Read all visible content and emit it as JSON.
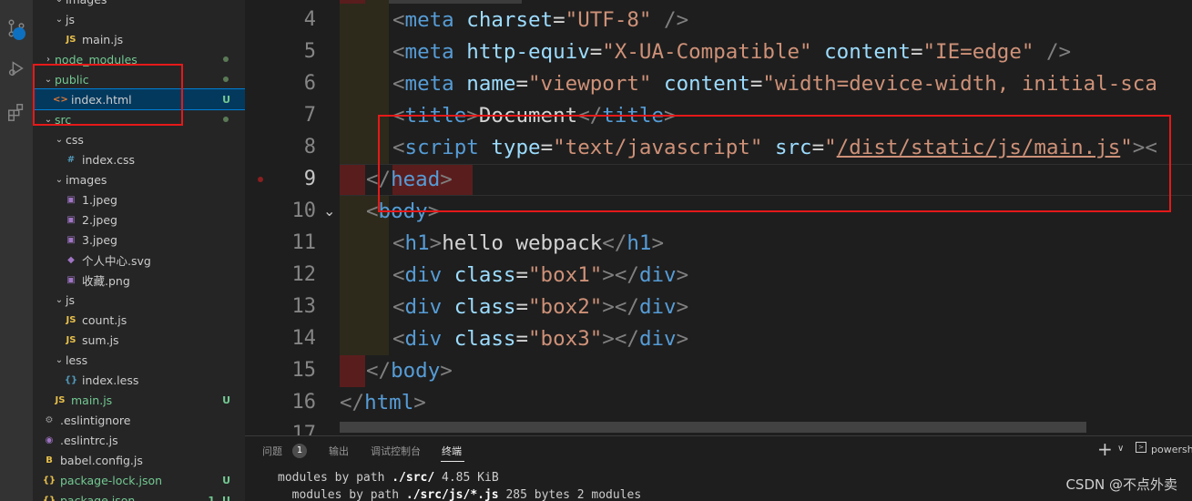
{
  "sidebar": {
    "rows": [
      {
        "label": "images",
        "kind": "folder",
        "depth": 1,
        "color": "",
        "deco": ""
      },
      {
        "label": "js",
        "kind": "folder",
        "depth": 1,
        "color": "",
        "deco": ""
      },
      {
        "label": "main.js",
        "kind": "js",
        "depth": 2,
        "color": "",
        "deco": ""
      },
      {
        "label": "node_modules",
        "kind": "folder-closed",
        "depth": 0,
        "color": "green",
        "deco": "dot"
      },
      {
        "label": "public",
        "kind": "folder",
        "depth": 0,
        "color": "green",
        "deco": "dot"
      },
      {
        "label": "index.html",
        "kind": "html",
        "depth": 1,
        "color": "",
        "deco": "U"
      },
      {
        "label": "src",
        "kind": "folder",
        "depth": 0,
        "color": "green",
        "deco": "dot"
      },
      {
        "label": "css",
        "kind": "folder",
        "depth": 1,
        "color": "",
        "deco": ""
      },
      {
        "label": "index.css",
        "kind": "css",
        "depth": 2,
        "color": "",
        "deco": ""
      },
      {
        "label": "images",
        "kind": "folder",
        "depth": 1,
        "color": "",
        "deco": ""
      },
      {
        "label": "1.jpeg",
        "kind": "img",
        "depth": 2,
        "color": "",
        "deco": ""
      },
      {
        "label": "2.jpeg",
        "kind": "img",
        "depth": 2,
        "color": "",
        "deco": ""
      },
      {
        "label": "3.jpeg",
        "kind": "img",
        "depth": 2,
        "color": "",
        "deco": ""
      },
      {
        "label": "个人中心.svg",
        "kind": "svg",
        "depth": 2,
        "color": "",
        "deco": ""
      },
      {
        "label": "收藏.png",
        "kind": "img",
        "depth": 2,
        "color": "",
        "deco": ""
      },
      {
        "label": "js",
        "kind": "folder",
        "depth": 1,
        "color": "",
        "deco": ""
      },
      {
        "label": "count.js",
        "kind": "js",
        "depth": 2,
        "color": "",
        "deco": ""
      },
      {
        "label": "sum.js",
        "kind": "js",
        "depth": 2,
        "color": "",
        "deco": ""
      },
      {
        "label": "less",
        "kind": "folder",
        "depth": 1,
        "color": "",
        "deco": ""
      },
      {
        "label": "index.less",
        "kind": "less",
        "depth": 2,
        "color": "",
        "deco": ""
      },
      {
        "label": "main.js",
        "kind": "js",
        "depth": 1,
        "color": "green",
        "deco": "U"
      },
      {
        "label": ".eslintignore",
        "kind": "gear",
        "depth": 0,
        "color": "",
        "deco": ""
      },
      {
        "label": ".eslintrc.js",
        "kind": "eslint",
        "depth": 0,
        "color": "",
        "deco": ""
      },
      {
        "label": "babel.config.js",
        "kind": "babel",
        "depth": 0,
        "color": "",
        "deco": ""
      },
      {
        "label": "package-lock.json",
        "kind": "json",
        "depth": 0,
        "color": "green",
        "deco": "U"
      },
      {
        "label": "package.json",
        "kind": "json",
        "depth": 0,
        "color": "green",
        "deco": "1, U"
      }
    ]
  },
  "editor": {
    "line_numbers": [
      "4",
      "5",
      "6",
      "7",
      "8",
      "9",
      "10",
      "11",
      "12",
      "13",
      "14",
      "15",
      "16",
      "17"
    ],
    "lines": [
      [
        [
          "brk",
          "<"
        ],
        [
          "tag",
          "meta"
        ],
        [
          "txt",
          " "
        ],
        [
          "attr",
          "charset"
        ],
        [
          "txt",
          "="
        ],
        [
          "str",
          "\"UTF-8\""
        ],
        [
          "txt",
          " "
        ],
        [
          "brk",
          "/>"
        ]
      ],
      [
        [
          "brk",
          "<"
        ],
        [
          "tag",
          "meta"
        ],
        [
          "txt",
          " "
        ],
        [
          "attr",
          "http-equiv"
        ],
        [
          "txt",
          "="
        ],
        [
          "str",
          "\"X-UA-Compatible\""
        ],
        [
          "txt",
          " "
        ],
        [
          "attr",
          "content"
        ],
        [
          "txt",
          "="
        ],
        [
          "str",
          "\"IE=edge\""
        ],
        [
          "txt",
          " "
        ],
        [
          "brk",
          "/>"
        ]
      ],
      [
        [
          "brk",
          "<"
        ],
        [
          "tag",
          "meta"
        ],
        [
          "txt",
          " "
        ],
        [
          "attr",
          "name"
        ],
        [
          "txt",
          "="
        ],
        [
          "str",
          "\"viewport\""
        ],
        [
          "txt",
          " "
        ],
        [
          "attr",
          "content"
        ],
        [
          "txt",
          "="
        ],
        [
          "str",
          "\"width=device-width, initial-sca"
        ]
      ],
      [
        [
          "brk",
          "<"
        ],
        [
          "tag",
          "title"
        ],
        [
          "brk",
          ">"
        ],
        [
          "txt",
          "Document"
        ],
        [
          "brk",
          "</"
        ],
        [
          "tag",
          "title"
        ],
        [
          "brk",
          ">"
        ]
      ],
      [
        [
          "brk",
          "<"
        ],
        [
          "tag",
          "script"
        ],
        [
          "txt",
          " "
        ],
        [
          "attr",
          "type"
        ],
        [
          "txt",
          "="
        ],
        [
          "str",
          "\"text/javascript\""
        ],
        [
          "txt",
          " "
        ],
        [
          "attr",
          "src"
        ],
        [
          "txt",
          "="
        ],
        [
          "str",
          "\""
        ],
        [
          "link",
          "/dist/static/js/main.js"
        ],
        [
          "str",
          "\""
        ],
        [
          "brk",
          "><"
        ]
      ],
      [
        [
          "brk",
          "</"
        ],
        [
          "tag",
          "head"
        ],
        [
          "brk",
          ">"
        ]
      ],
      [
        [
          "brk",
          "<"
        ],
        [
          "tag",
          "body"
        ],
        [
          "brk",
          ">"
        ]
      ],
      [
        [
          "brk",
          "<"
        ],
        [
          "tag",
          "h1"
        ],
        [
          "brk",
          ">"
        ],
        [
          "txt",
          "hello webpack"
        ],
        [
          "brk",
          "</"
        ],
        [
          "tag",
          "h1"
        ],
        [
          "brk",
          ">"
        ]
      ],
      [
        [
          "brk",
          "<"
        ],
        [
          "tag",
          "div"
        ],
        [
          "txt",
          " "
        ],
        [
          "attr",
          "class"
        ],
        [
          "txt",
          "="
        ],
        [
          "str",
          "\"box1\""
        ],
        [
          "brk",
          "></"
        ],
        [
          "tag",
          "div"
        ],
        [
          "brk",
          ">"
        ]
      ],
      [
        [
          "brk",
          "<"
        ],
        [
          "tag",
          "div"
        ],
        [
          "txt",
          " "
        ],
        [
          "attr",
          "class"
        ],
        [
          "txt",
          "="
        ],
        [
          "str",
          "\"box2\""
        ],
        [
          "brk",
          "></"
        ],
        [
          "tag",
          "div"
        ],
        [
          "brk",
          ">"
        ]
      ],
      [
        [
          "brk",
          "<"
        ],
        [
          "tag",
          "div"
        ],
        [
          "txt",
          " "
        ],
        [
          "attr",
          "class"
        ],
        [
          "txt",
          "="
        ],
        [
          "str",
          "\"box3\""
        ],
        [
          "brk",
          "></"
        ],
        [
          "tag",
          "div"
        ],
        [
          "brk",
          ">"
        ]
      ],
      [
        [
          "brk",
          "</"
        ],
        [
          "tag",
          "body"
        ],
        [
          "brk",
          ">"
        ]
      ],
      [
        [
          "brk",
          "</"
        ],
        [
          "tag",
          "html"
        ],
        [
          "brk",
          ">"
        ]
      ]
    ],
    "fold_chevron": "⌄"
  },
  "panel": {
    "tabs": [
      "问题",
      "输出",
      "调试控制台",
      "终端"
    ],
    "problems_count": "1",
    "add_icon": "+",
    "shell_label": "powershe",
    "terminal": {
      "line1_prefix": "modules by path ",
      "line1_path": "./src/",
      "line1_rest": " 4.85 KiB",
      "line2_prefix": "  modules by path ",
      "line2_path": "./src/js/*.js",
      "line2_rest": " 285 bytes 2 modules"
    }
  },
  "watermark": "CSDN @不点外卖"
}
